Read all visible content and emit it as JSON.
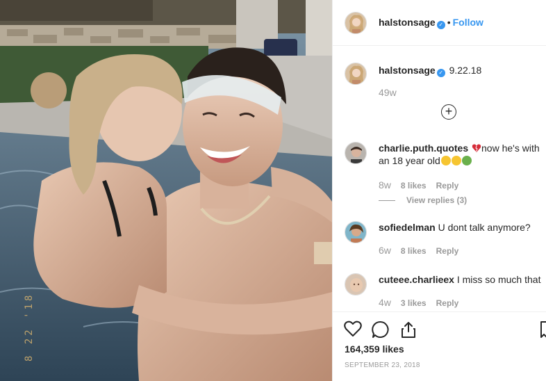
{
  "post": {
    "author": "halstonsage",
    "follow_label": "Follow",
    "separator": "•",
    "verified_glyph": "✓",
    "photo_stamp": "8 22 '18"
  },
  "caption": {
    "author": "halstonsage",
    "text": "9.22.18",
    "time": "49w",
    "load_more_icon": "plus-circle-icon"
  },
  "comments": [
    {
      "author": "charlie.puth.quotes",
      "text_before": "now he's with an 18 year old",
      "time": "8w",
      "likes": "8 likes",
      "reply_label": "Reply",
      "view_replies": "View replies (3)"
    },
    {
      "author": "sofiedelman",
      "text": "U dont talk anymore?",
      "time": "6w",
      "likes": "8 likes",
      "reply_label": "Reply"
    },
    {
      "author": "cuteee.charlieex",
      "text": "I miss so much that",
      "time": "4w",
      "likes": "3 likes",
      "reply_label": "Reply"
    }
  ],
  "footer": {
    "likes_count": "164,359 likes",
    "date": "SEPTEMBER 23, 2018"
  },
  "colors": {
    "accent": "#3897f0",
    "muted": "#999999",
    "text": "#262626"
  }
}
